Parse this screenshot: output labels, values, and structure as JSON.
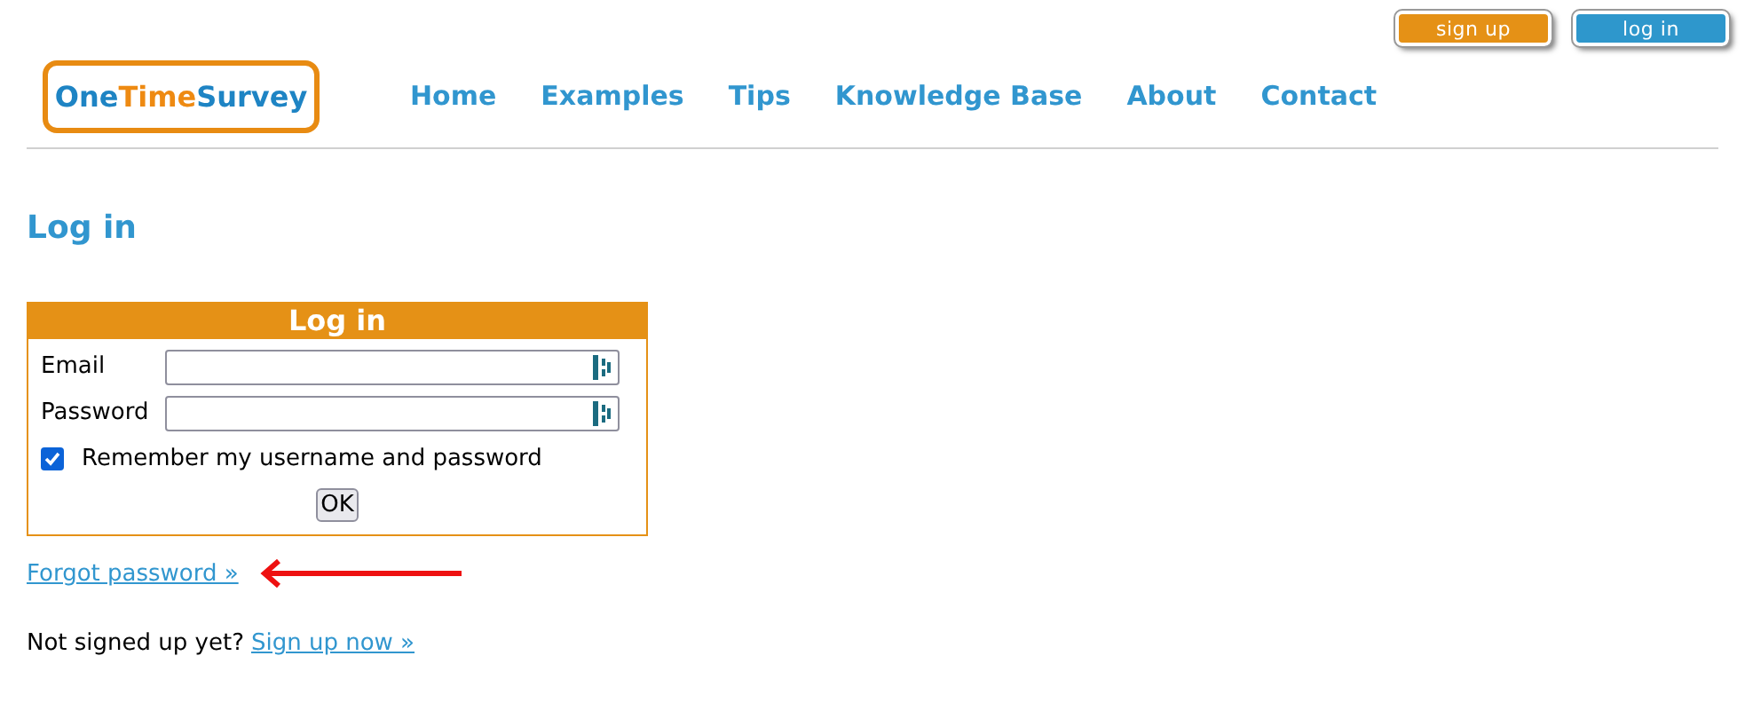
{
  "top_buttons": [
    {
      "label": "sign up",
      "kind": "signup"
    },
    {
      "label": "log in",
      "kind": "login"
    }
  ],
  "logo": [
    {
      "text": "One",
      "kind": "plain"
    },
    {
      "text": "Time",
      "kind": "accent"
    },
    {
      "text": "Survey",
      "kind": "plain"
    }
  ],
  "nav": [
    "Home",
    "Examples",
    "Tips",
    "Knowledge Base",
    "About",
    "Contact"
  ],
  "heading": "Log in",
  "form": {
    "title": "Log in",
    "fields": [
      {
        "label": "Email"
      },
      {
        "label": "Password"
      }
    ],
    "remember": {
      "label": "Remember my username and password",
      "checked": true
    },
    "submit": "OK"
  },
  "forgot_link": "Forgot password »",
  "signup_prompt": "Not signed up yet?",
  "signup_link": "Sign up now »"
}
